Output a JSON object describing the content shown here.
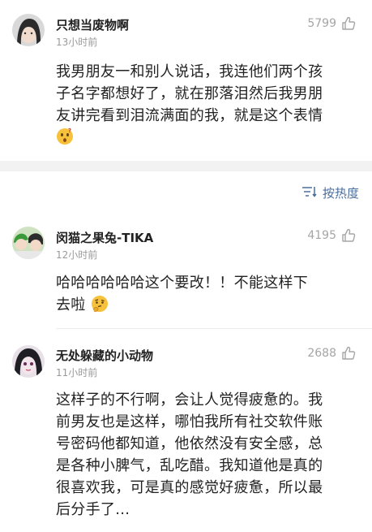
{
  "comments": [
    {
      "username": "只想当废物啊",
      "time": "13小时前",
      "likes": "5799",
      "lines": [
        "我男朋友一和别人说话，我连他们两个孩",
        "子名字都想好了，就在那落泪然后我男朋",
        "友讲完看到泪流满面的我，就是这个表情"
      ],
      "emoji_icon": "surprised-face-icon"
    },
    {
      "username": "闵猫之果兔-TIKA",
      "time": "12小时前",
      "likes": "4195",
      "lines": [
        "哈哈哈哈哈哈这个要改！！不能这样下",
        "去啦"
      ],
      "emoji_icon": "thinking-face-icon"
    },
    {
      "username": "无处躲藏的小动物",
      "time": "11小时前",
      "likes": "2688",
      "lines": [
        "这样子的不行啊，会让人觉得疲惫的。我",
        "前男友也是这样，哪怕我所有社交软件账",
        "号密码他都知道，他依然没有安全感，总",
        "是各种小脾气，乱吃醋。我知道他是真的",
        "很喜欢我，可是真的感觉好疲惫，所以最",
        "后分手了..."
      ]
    }
  ],
  "sort": {
    "label": "按热度",
    "icon": "sort-icon"
  },
  "colors": {
    "link": "#4a6f9e",
    "meta": "#9a9a9a",
    "gap": "#f2f2f2"
  }
}
